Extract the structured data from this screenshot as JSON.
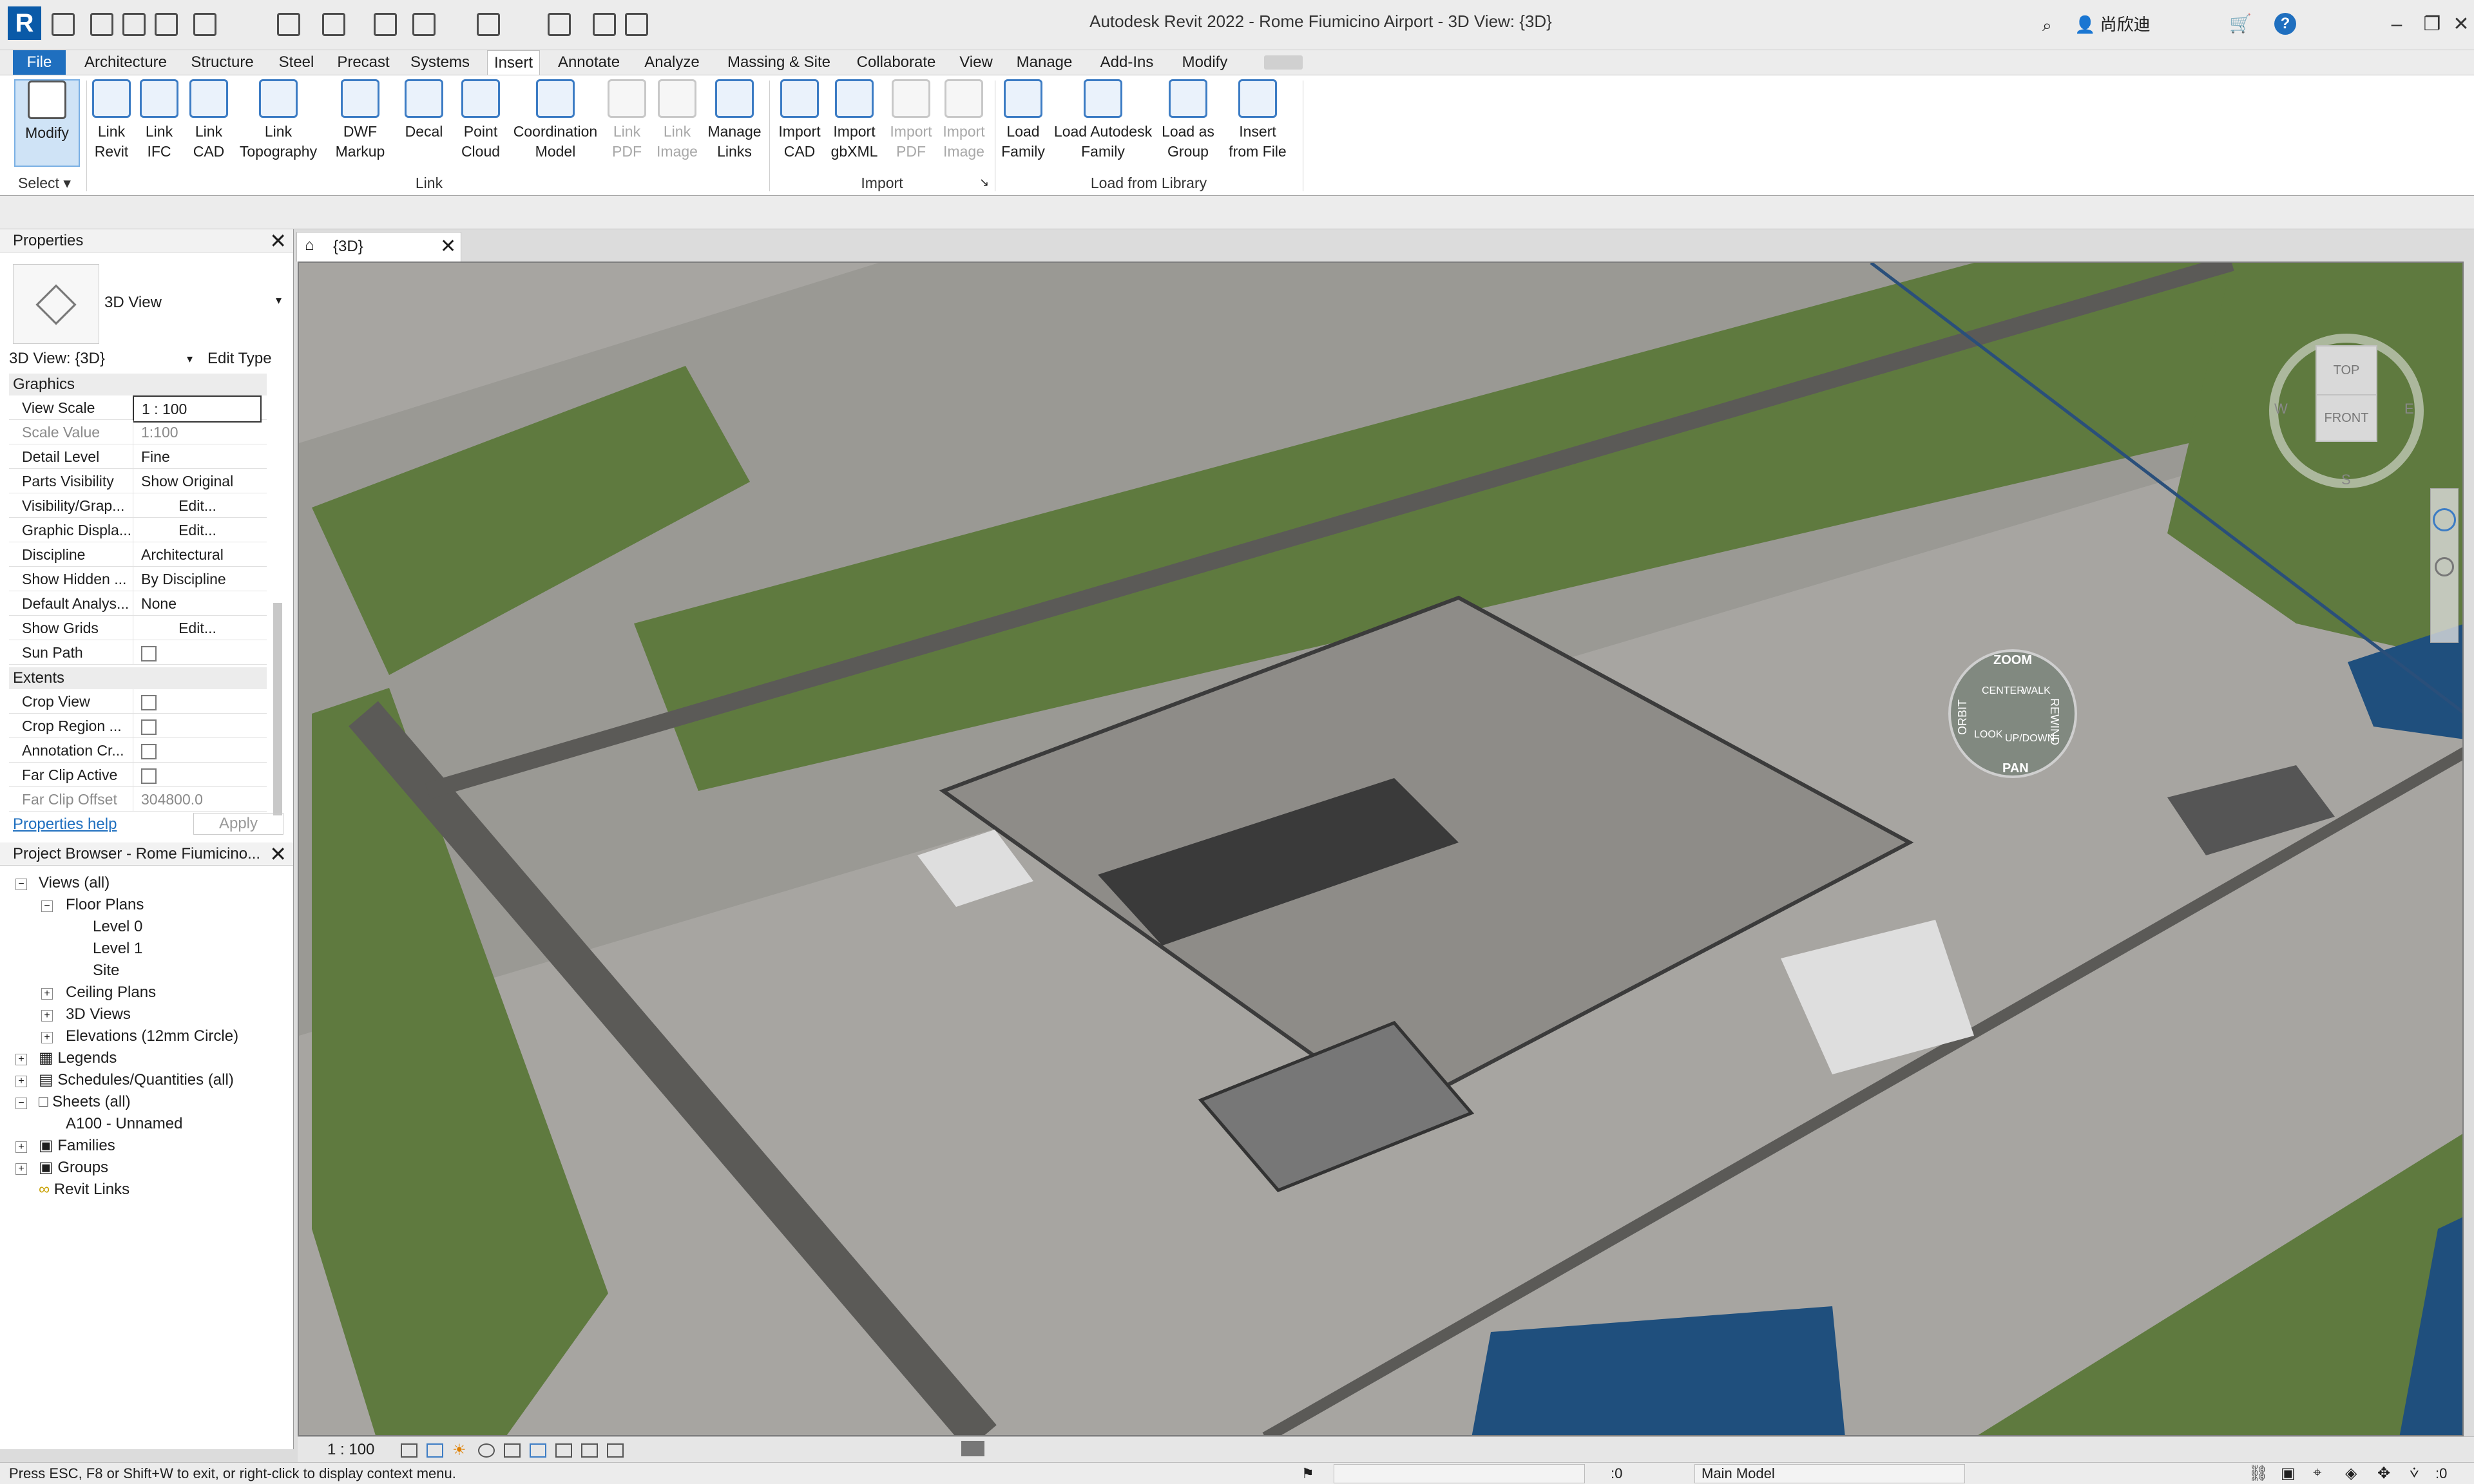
{
  "app": {
    "title": "Autodesk Revit 2022 - Rome Fiumicino Airport - 3D View: {3D}",
    "logo": "R",
    "user": "尚欣迪"
  },
  "tabs": [
    "File",
    "Architecture",
    "Structure",
    "Steel",
    "Precast",
    "Systems",
    "Insert",
    "Annotate",
    "Analyze",
    "Massing & Site",
    "Collaborate",
    "View",
    "Manage",
    "Add-Ins",
    "Modify"
  ],
  "active_tab": "Insert",
  "ribbon": {
    "modify": "Modify",
    "select": "Select",
    "buttons": [
      {
        "label": "Link Revit",
        "icon": "link-revit-icon",
        "enabled": true
      },
      {
        "label": "Link IFC",
        "icon": "link-ifc-icon",
        "enabled": true
      },
      {
        "label": "Link CAD",
        "icon": "link-cad-icon",
        "enabled": true
      },
      {
        "label": "Link Topography",
        "icon": "link-topography-icon",
        "enabled": true
      },
      {
        "label": "DWF Markup",
        "icon": "dwf-markup-icon",
        "enabled": true
      },
      {
        "label": "Decal",
        "icon": "decal-icon",
        "enabled": true
      },
      {
        "label": "Point Cloud",
        "icon": "point-cloud-icon",
        "enabled": true
      },
      {
        "label": "Coordination Model",
        "icon": "coordination-model-icon",
        "enabled": true
      },
      {
        "label": "Link PDF",
        "icon": "link-pdf-icon",
        "enabled": false
      },
      {
        "label": "Link Image",
        "icon": "link-image-icon",
        "enabled": false
      },
      {
        "label": "Manage Links",
        "icon": "manage-links-icon",
        "enabled": true
      },
      {
        "label": "Import CAD",
        "icon": "import-cad-icon",
        "enabled": true
      },
      {
        "label": "Import gbXML",
        "icon": "import-gbxml-icon",
        "enabled": true
      },
      {
        "label": "Import PDF",
        "icon": "import-pdf-icon",
        "enabled": false
      },
      {
        "label": "Import Image",
        "icon": "import-image-icon",
        "enabled": false
      },
      {
        "label": "Load Family",
        "icon": "load-family-icon",
        "enabled": true
      },
      {
        "label": "Load Autodesk Family",
        "icon": "load-autodesk-family-icon",
        "enabled": true
      },
      {
        "label": "Load as Group",
        "icon": "load-as-group-icon",
        "enabled": true
      },
      {
        "label": "Insert from File",
        "icon": "insert-from-file-icon",
        "enabled": true
      }
    ],
    "panels": {
      "link": "Link",
      "import": "Import",
      "load": "Load from Library"
    }
  },
  "properties": {
    "title": "Properties",
    "type_name": "3D View",
    "instance": "3D View: {3D}",
    "edit_type": "Edit Type",
    "section_graphics": "Graphics",
    "section_extents": "Extents",
    "rows": [
      {
        "key": "View Scale",
        "value": "1 : 100"
      },
      {
        "key": "Scale Value",
        "value": "1:100"
      },
      {
        "key": "Detail Level",
        "value": "Fine"
      },
      {
        "key": "Parts Visibility",
        "value": "Show Original"
      },
      {
        "key": "Visibility/Grap...",
        "value": "Edit..."
      },
      {
        "key": "Graphic Displa...",
        "value": "Edit..."
      },
      {
        "key": "Discipline",
        "value": "Architectural"
      },
      {
        "key": "Show Hidden ...",
        "value": "By Discipline"
      },
      {
        "key": "Default Analys...",
        "value": "None"
      },
      {
        "key": "Show Grids",
        "value": "Edit..."
      },
      {
        "key": "Sun Path",
        "value": ""
      }
    ],
    "extents": [
      {
        "key": "Crop View",
        "value": ""
      },
      {
        "key": "Crop Region ...",
        "value": ""
      },
      {
        "key": "Annotation Cr...",
        "value": ""
      },
      {
        "key": "Far Clip Active",
        "value": ""
      },
      {
        "key": "Far Clip Offset",
        "value": "304800.0"
      }
    ],
    "help": "Properties help",
    "apply": "Apply"
  },
  "browser": {
    "title": "Project Browser - Rome Fiumicino...",
    "nodes": [
      {
        "label": "Views (all)",
        "depth": 0,
        "exp": "-"
      },
      {
        "label": "Floor Plans",
        "depth": 1,
        "exp": "-"
      },
      {
        "label": "Level 0",
        "depth": 2,
        "exp": ""
      },
      {
        "label": "Level 1",
        "depth": 2,
        "exp": ""
      },
      {
        "label": "Site",
        "depth": 2,
        "exp": ""
      },
      {
        "label": "Ceiling Plans",
        "depth": 1,
        "exp": "+"
      },
      {
        "label": "3D Views",
        "depth": 1,
        "exp": "+"
      },
      {
        "label": "Elevations (12mm Circle)",
        "depth": 1,
        "exp": "+"
      },
      {
        "label": "Legends",
        "depth": 0,
        "exp": "+"
      },
      {
        "label": "Schedules/Quantities (all)",
        "depth": 0,
        "exp": "+"
      },
      {
        "label": "Sheets (all)",
        "depth": 0,
        "exp": "-"
      },
      {
        "label": "A100 - Unnamed",
        "depth": 1,
        "exp": ""
      },
      {
        "label": "Families",
        "depth": 0,
        "exp": "+"
      },
      {
        "label": "Groups",
        "depth": 0,
        "exp": "+"
      },
      {
        "label": "Revit Links",
        "depth": 0,
        "exp": ""
      }
    ]
  },
  "view": {
    "tab": "{3D}",
    "scale": "1 : 100",
    "cube_top": "TOP",
    "cube_front": "FRONT",
    "compass": {
      "s": "S",
      "w": "W",
      "e": "E"
    },
    "wheel": {
      "zoom": "ZOOM",
      "rewind": "REWIND",
      "pan": "PAN",
      "orbit": "ORBIT",
      "center": "CENTER",
      "walk": "WALK",
      "up_down": "UP/DOWN",
      "look": "LOOK"
    }
  },
  "status": {
    "message": "Press ESC, F8 or Shift+W to exit, or right-click to display context menu.",
    "workset": "Main Model",
    "count": ":0",
    "filter": ":0"
  },
  "colors": {
    "grass": "#5f7a3f",
    "water": "#1f4f7d",
    "tarmac": "#a7a5a1",
    "accent": "#1f6fbf"
  }
}
